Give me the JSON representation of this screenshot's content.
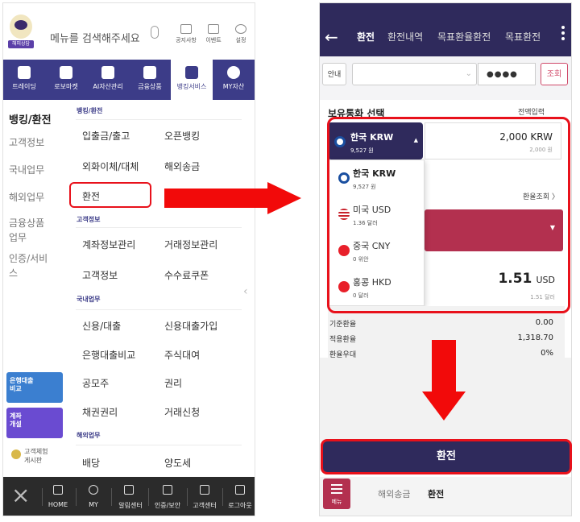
{
  "left": {
    "search_placeholder": "메뉴를 검색해주세요",
    "logo_text": "해피상담",
    "top_tools": [
      "공지사항",
      "이벤트",
      "설정"
    ],
    "nav": [
      "트레이딩",
      "로보마켓",
      "AI자산관리",
      "금융상품",
      "뱅킹서비스",
      "MY자산"
    ],
    "left_title": "뱅킹/환전",
    "left_items": [
      "고객정보",
      "국내업무",
      "해외업무",
      "금융상품\n업무",
      "인증/서비\n스"
    ],
    "sections": {
      "s1": "뱅킹/환전",
      "s2": "고객정보",
      "s3": "국내업무",
      "s4": "해외업무"
    },
    "menu": {
      "r1a": "입출금/출고",
      "r1b": "오픈뱅킹",
      "r2a": "외화이체/대체",
      "r2b": "해외송금",
      "r3a": "환전",
      "r4a": "계좌정보관리",
      "r4b": "거래정보관리",
      "r5a": "고객정보",
      "r5b": "수수료쿠폰",
      "r6a": "신용/대출",
      "r6b": "신용대출가입",
      "r7a": "은행대출비교",
      "r7b": "주식대여",
      "r8a": "공모주",
      "r8b": "권리",
      "r9a": "채권권리",
      "r9b": "거래신청",
      "r10a": "배당",
      "r10b": "양도세"
    },
    "banners": {
      "b1": "은행대출\n비교",
      "b2": "계좌\n개설",
      "b3": "고객체험\n게시판"
    },
    "bottom": [
      "HOME",
      "MY",
      "알림센터",
      "인증/보안",
      "고객센터",
      "로그아웃"
    ]
  },
  "right": {
    "tabs": [
      "환전",
      "환전내역",
      "목표환율환전",
      "목표환전"
    ],
    "guide": "안내",
    "pw": "●●●●",
    "inquire": "조회",
    "held_label": "보유통화 선택",
    "full_input": "전액입력",
    "selected": {
      "name": "한국 KRW",
      "amount": "9,527 원"
    },
    "amount_main": "2,000 KRW",
    "amount_sub": "2,000 원",
    "dropdown": [
      {
        "name": "한국 KRW",
        "sub": "9,527 원",
        "color": "#1a4fa0"
      },
      {
        "name": "미국 USD",
        "sub": "1.36 달러",
        "color": "#3a5bb8"
      },
      {
        "name": "중국 CNY",
        "sub": "0 위안",
        "color": "#e8202a"
      },
      {
        "name": "홍콩 HKD",
        "sub": "0 달러",
        "color": "#e8202a"
      }
    ],
    "rate_lookup": "환율조회 〉",
    "usd_main": "1.51",
    "usd_unit": "USD",
    "usd_sub": "1.51 달러",
    "rates": [
      {
        "k": "기준환율",
        "v": "0.00"
      },
      {
        "k": "적용환율",
        "v": "1,318.70"
      },
      {
        "k": "환율우대",
        "v": "0%"
      }
    ],
    "exchange_btn": "환전",
    "menu_label": "메뉴",
    "bottom_tabs": [
      "해외송금",
      "환전"
    ]
  }
}
